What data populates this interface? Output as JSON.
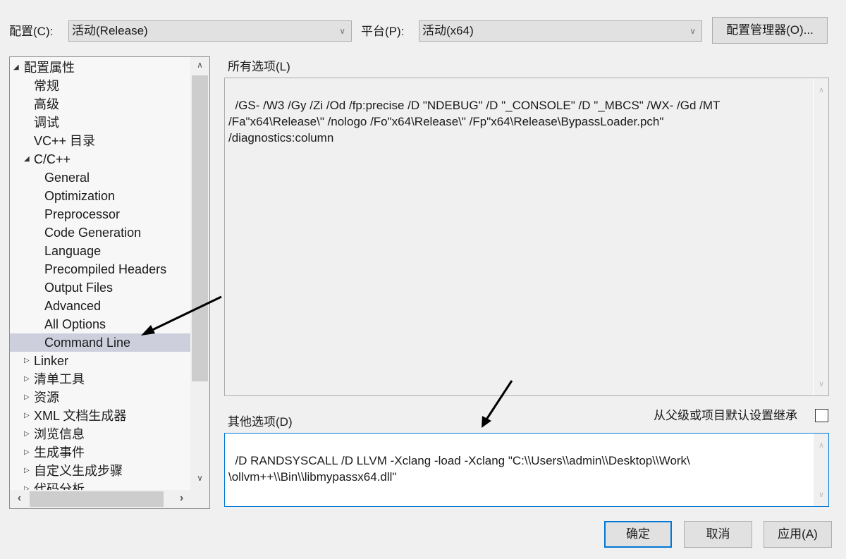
{
  "toolbar": {
    "config_label": "配置(C):",
    "config_value": "活动(Release)",
    "platform_label": "平台(P):",
    "platform_value": "活动(x64)",
    "config_manager_button": "配置管理器(O)..."
  },
  "tree": {
    "items": [
      {
        "label": "配置属性",
        "level": 0,
        "expander": "expanded"
      },
      {
        "label": "常规",
        "level": 1,
        "expander": "none"
      },
      {
        "label": "高级",
        "level": 1,
        "expander": "none"
      },
      {
        "label": "调试",
        "level": 1,
        "expander": "none"
      },
      {
        "label": "VC++ 目录",
        "level": 1,
        "expander": "none"
      },
      {
        "label": "C/C++",
        "level": 1,
        "expander": "expanded"
      },
      {
        "label": "General",
        "level": 2,
        "expander": "none"
      },
      {
        "label": "Optimization",
        "level": 2,
        "expander": "none"
      },
      {
        "label": "Preprocessor",
        "level": 2,
        "expander": "none"
      },
      {
        "label": "Code Generation",
        "level": 2,
        "expander": "none"
      },
      {
        "label": "Language",
        "level": 2,
        "expander": "none"
      },
      {
        "label": "Precompiled Headers",
        "level": 2,
        "expander": "none"
      },
      {
        "label": "Output Files",
        "level": 2,
        "expander": "none"
      },
      {
        "label": "Advanced",
        "level": 2,
        "expander": "none"
      },
      {
        "label": "All Options",
        "level": 2,
        "expander": "none"
      },
      {
        "label": "Command Line",
        "level": 2,
        "expander": "none",
        "selected": true
      },
      {
        "label": "Linker",
        "level": 1,
        "expander": "collapsed"
      },
      {
        "label": "清单工具",
        "level": 1,
        "expander": "collapsed"
      },
      {
        "label": "资源",
        "level": 1,
        "expander": "collapsed"
      },
      {
        "label": "XML 文档生成器",
        "level": 1,
        "expander": "collapsed"
      },
      {
        "label": "浏览信息",
        "level": 1,
        "expander": "collapsed"
      },
      {
        "label": "生成事件",
        "level": 1,
        "expander": "collapsed"
      },
      {
        "label": "自定义生成步骤",
        "level": 1,
        "expander": "collapsed"
      },
      {
        "label": "代码分析",
        "level": 1,
        "expander": "collapsed"
      }
    ]
  },
  "all_options": {
    "label": "所有选项(L)",
    "value": "/GS- /W3 /Gy /Zi /Od /fp:precise /D \"NDEBUG\" /D \"_CONSOLE\" /D \"_MBCS\" /WX- /Gd /MT\n/Fa\"x64\\Release\\\" /nologo /Fo\"x64\\Release\\\" /Fp\"x64\\Release\\BypassLoader.pch\"\n/diagnostics:column"
  },
  "additional_options": {
    "label": "其他选项(D)",
    "inherit_label": "从父级或项目默认设置继承",
    "inherit_checked": false,
    "value": "/D RANDSYSCALL /D LLVM -Xclang -load -Xclang \"C:\\\\Users\\\\admin\\\\Desktop\\\\Work\\\n\\ollvm++\\\\Bin\\\\libmypassx64.dll\""
  },
  "footer": {
    "ok_button": "确定",
    "cancel_button": "取消",
    "apply_button": "应用(A)"
  },
  "icons": {
    "expanded": "◢",
    "collapsed": "▷",
    "chevron_down": "﹀",
    "scroll_up": "︿",
    "scroll_down": "﹀",
    "scroll_left": "‹",
    "scroll_right": "›"
  }
}
